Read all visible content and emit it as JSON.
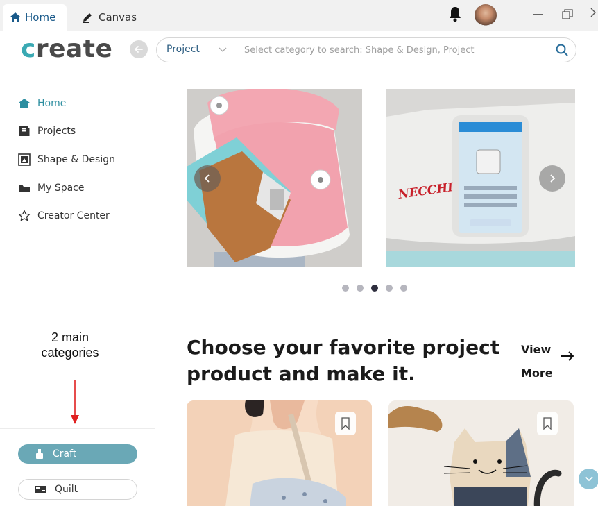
{
  "titlebar": {
    "tabs": [
      {
        "label": "Home",
        "icon": "home-icon"
      },
      {
        "label": "Canvas",
        "icon": "pen-icon"
      }
    ],
    "icons": [
      "bell-icon",
      "avatar",
      "minimize-icon",
      "maximize-icon",
      "close-icon"
    ]
  },
  "header": {
    "logo_first": "c",
    "logo_rest": "reate",
    "search": {
      "category": "Project",
      "placeholder": "Select category to search: Shape & Design, Project"
    }
  },
  "sidebar": {
    "items": [
      {
        "label": "Home",
        "icon": "home-icon",
        "active": true
      },
      {
        "label": "Projects",
        "icon": "projects-icon"
      },
      {
        "label": "Shape & Design",
        "icon": "shape-design-icon"
      },
      {
        "label": "My Space",
        "icon": "folder-icon"
      },
      {
        "label": "Creator Center",
        "icon": "star-icon"
      }
    ],
    "categories": [
      {
        "label": "Craft",
        "icon": "craft-icon",
        "selected": true
      },
      {
        "label": "Quilt",
        "icon": "quilt-icon",
        "selected": false
      }
    ]
  },
  "annotation": {
    "line1": "2 main",
    "line2": "categories",
    "color": "#e02020"
  },
  "carousel": {
    "slide2_brand": "NECCHI",
    "slide_count": 5,
    "active_index": 2
  },
  "section": {
    "title": "Choose your favorite project product and make it.",
    "view": "View",
    "more": "More"
  },
  "colors": {
    "accent": "#3aa9b3",
    "craft_button": "#6aa8b6",
    "nav_active": "#2d8ea0",
    "link_blue": "#2b5c80"
  }
}
